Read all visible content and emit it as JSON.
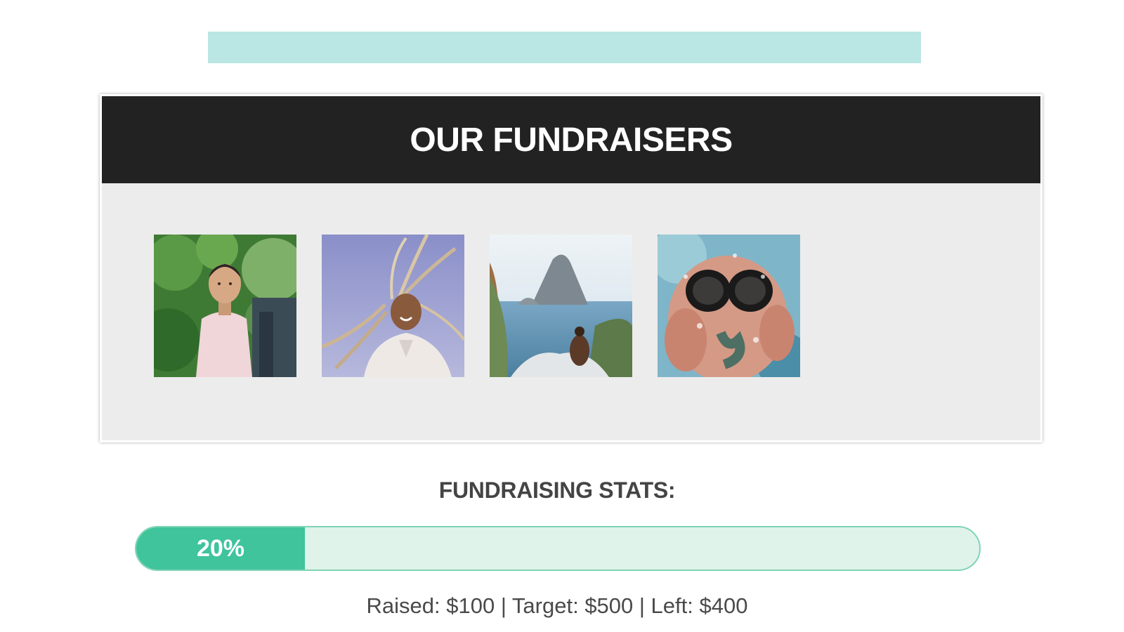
{
  "colors": {
    "banner": "#bae6e3",
    "header_bg": "#222222",
    "card_bg": "#ececec",
    "progress_fill": "#3fc49c",
    "progress_track": "#dff3ea",
    "progress_border": "#7fd4b4"
  },
  "fundraisers": {
    "title": "OUR FUNDRAISERS",
    "photos": [
      {
        "name": "woman-in-garden-photo"
      },
      {
        "name": "woman-with-braids-photo"
      },
      {
        "name": "person-by-sea-rock-photo"
      },
      {
        "name": "snorkeler-underwater-photo"
      }
    ]
  },
  "stats": {
    "title": "FUNDRAISING STATS:",
    "percent": 20,
    "percent_label": "20%",
    "summary": "Raised: $100 | Target: $500 | Left: $400"
  }
}
